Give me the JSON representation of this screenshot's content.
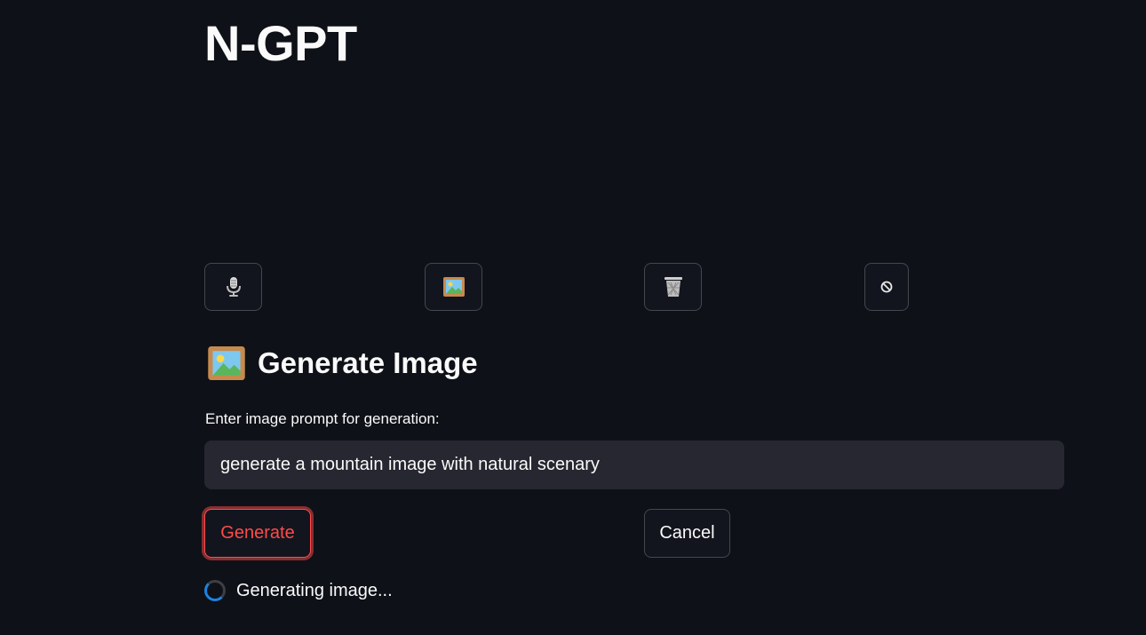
{
  "app": {
    "title": "N-GPT"
  },
  "toolbar": {
    "buttons": [
      {
        "name": "microphone",
        "icon": "microphone-icon"
      },
      {
        "name": "image",
        "icon": "framed-picture-icon"
      },
      {
        "name": "delete",
        "icon": "wastebasket-icon"
      },
      {
        "name": "stop",
        "icon": "prohibited-icon"
      }
    ]
  },
  "section": {
    "icon": "framed-picture-icon",
    "title": "Generate Image"
  },
  "prompt": {
    "label": "Enter image prompt for generation:",
    "value": "generate a mountain image with natural scenary"
  },
  "actions": {
    "generate_label": "Generate",
    "cancel_label": "Cancel"
  },
  "status": {
    "text": "Generating image..."
  },
  "colors": {
    "background": "#0e1117",
    "input_bg": "#262730",
    "accent": "#ff4b4b",
    "spinner": "#1c83e1",
    "text": "#fafafa"
  }
}
